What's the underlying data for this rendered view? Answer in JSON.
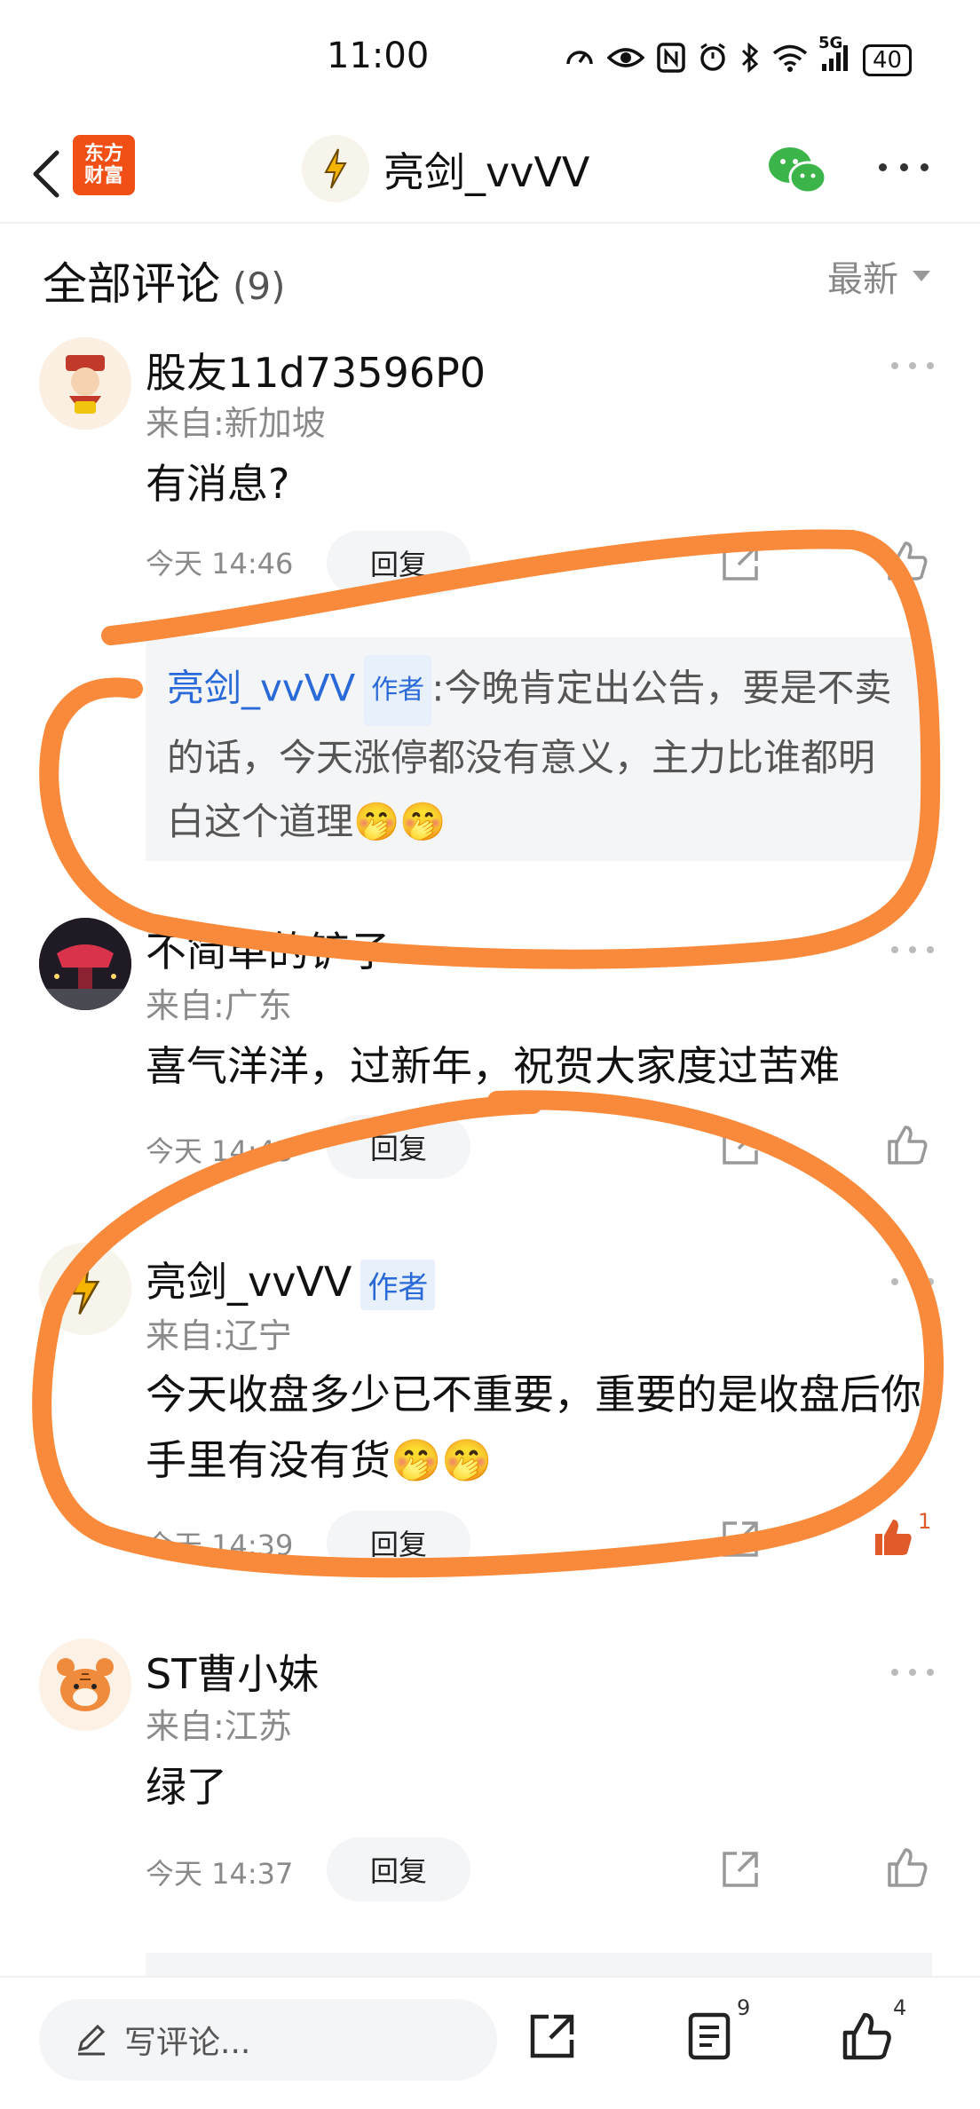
{
  "status_bar": {
    "time": "11:00",
    "network": "5G",
    "battery": "40",
    "icons": [
      "speedometer-icon",
      "eye-icon",
      "nfc-icon",
      "alarm-icon",
      "bluetooth-icon",
      "wifi-icon",
      "signal-icon"
    ]
  },
  "nav": {
    "logo_line1": "东方",
    "logo_line2": "财富",
    "title": "亮剑_vvVV",
    "icons": [
      "back-arrow-icon",
      "lightning-icon",
      "wechat-icon",
      "more-icon"
    ]
  },
  "section": {
    "title": "全部评论",
    "count": "(9)",
    "sort_label": "最新"
  },
  "comments": [
    {
      "user": "股友11d73596P0",
      "location": "来自:新加坡",
      "content": "有消息?",
      "time": "今天 14:46",
      "reply_label": "回复",
      "reply_preview": {
        "name": "亮剑_vvVV",
        "tag": "作者",
        "text": ":今晚肯定出公告，要是不卖的话，今天涨停都没有意义，主力比谁都明白这个道理🤭🤭"
      }
    },
    {
      "user": "不简单的铲子",
      "location": "来自:广东",
      "content": "喜气洋洋，过新年，祝贺大家度过苦难",
      "time": "今天 14:43",
      "reply_label": "回复"
    },
    {
      "user": "亮剑_vvVV",
      "tag": "作者",
      "location": "来自:辽宁",
      "content": "今天收盘多少已不重要，重要的是收盘后你手里有没有货🤭🤭",
      "time": "今天 14:39",
      "reply_label": "回复",
      "likes": "1"
    },
    {
      "user": "ST曹小妹",
      "location": "来自:江苏",
      "content": "绿了",
      "time": "今天 14:37",
      "reply_label": "回复"
    }
  ],
  "bottom_bar": {
    "input_placeholder": "写评论...",
    "comments_count": "9",
    "likes_count": "4"
  },
  "colors": {
    "brand": "#f24f16",
    "link_blue": "#2a6ad8",
    "annotation": "#f98a3b",
    "like_active": "#e05a2a"
  }
}
